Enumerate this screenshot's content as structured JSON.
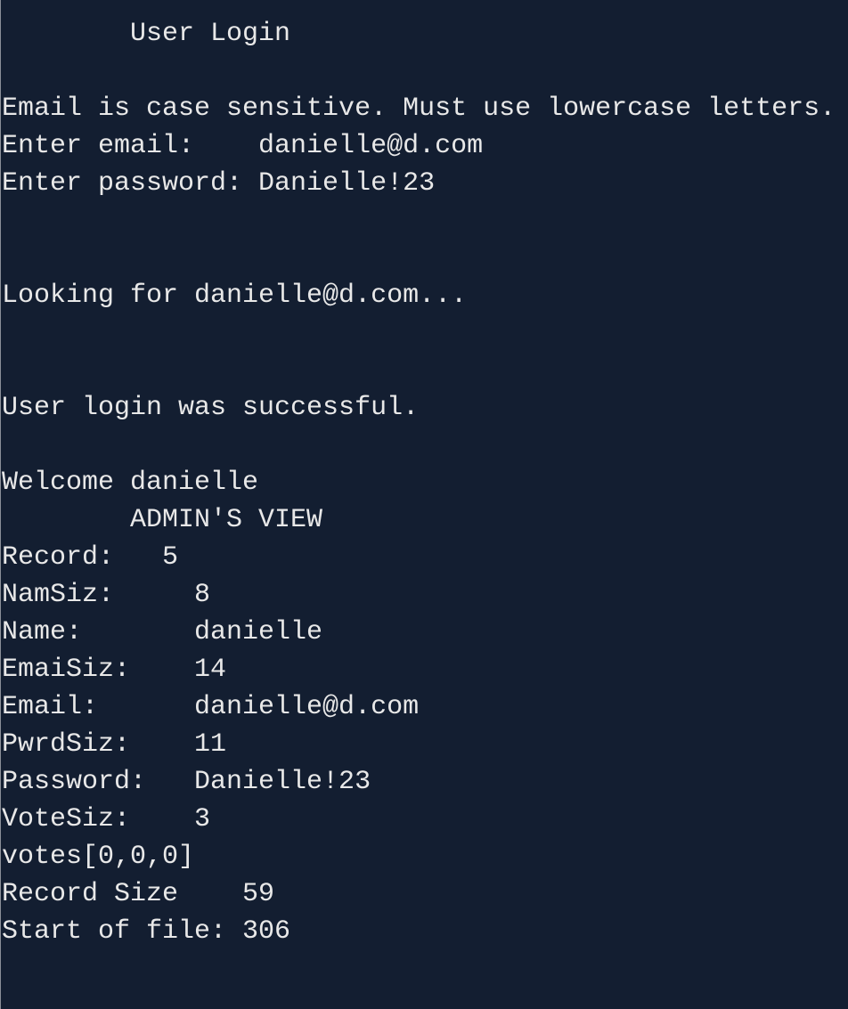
{
  "terminal": {
    "lines": [
      "        User Login",
      "",
      "Email is case sensitive. Must use lowercase letters.",
      "Enter email:    danielle@d.com",
      "Enter password: Danielle!23",
      "",
      "",
      "Looking for danielle@d.com...",
      "",
      "",
      "User login was successful.",
      "",
      "Welcome danielle",
      "        ADMIN'S VIEW",
      "Record:   5",
      "NamSiz:     8",
      "Name:       danielle",
      "EmaiSiz:    14",
      "Email:      danielle@d.com",
      "PwrdSiz:    11",
      "Password:   Danielle!23",
      "VoteSiz:    3",
      "votes[0,0,0]",
      "Record Size    59",
      "Start of file: 306"
    ]
  },
  "colors": {
    "background": "#131e31",
    "text": "#e8e8e8"
  }
}
